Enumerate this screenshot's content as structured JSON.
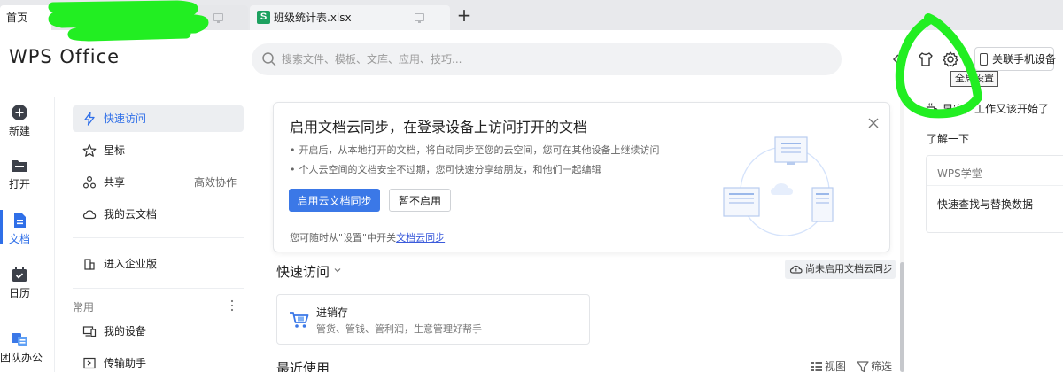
{
  "tabs": {
    "home": "首页",
    "file": {
      "badge": "S",
      "name": "班级统计表.xlsx"
    },
    "add": "+"
  },
  "header": {
    "logo": "WPS Office",
    "search_placeholder": "搜索文件、模板、文库、应用、技巧...",
    "phone_button": "关联手机设备",
    "tooltip": "全局设置"
  },
  "rail": [
    {
      "label": "新建",
      "icon": "plus-circle-icon"
    },
    {
      "label": "打开",
      "icon": "folder-icon"
    },
    {
      "label": "文档",
      "icon": "document-icon"
    },
    {
      "label": "日历",
      "icon": "calendar-icon"
    },
    {
      "label": "团队办公",
      "icon": "team-icon"
    }
  ],
  "nav": {
    "items": [
      {
        "label": "快速访问",
        "icon": "lightning-icon"
      },
      {
        "label": "星标",
        "icon": "star-icon"
      },
      {
        "label": "共享",
        "icon": "share-icon",
        "extra": "高效协作"
      },
      {
        "label": "我的云文档",
        "icon": "cloud-icon"
      },
      {
        "label": "进入企业版",
        "icon": "enterprise-icon"
      }
    ],
    "section_label": "常用",
    "common_items": [
      {
        "label": "我的设备",
        "icon": "device-icon"
      },
      {
        "label": "传输助手",
        "icon": "transfer-icon"
      }
    ]
  },
  "sync_card": {
    "title": "启用文档云同步，在登录设备上访问打开的文档",
    "lines": [
      "开启后，从本地打开的文档，将自动同步至您的云空间，您可在其他设备上继续访问",
      "个人云空间的文档安全不过期，您可快速分享给朋友，和他们一起编辑"
    ],
    "primary_button": "启用云文档同步",
    "secondary_button": "暂不启用",
    "footer_prefix": "您可随时从\"设置\"中开关",
    "footer_link": "文档云同步"
  },
  "quick_access": {
    "title": "快速访问",
    "cloud_status": "尚未启用文档云同步",
    "card": {
      "title": "进销存",
      "subtitle": "管货、管钱、管利润，生意管理好帮手"
    }
  },
  "recent": {
    "title": "最近使用",
    "view_label": "视图",
    "filter_label": "筛选"
  },
  "right_panel": {
    "greeting": "早安，工作又该开始了",
    "learn_more": "了解一下",
    "school": {
      "title": "WPS学堂",
      "item": "快速查找与替换数据"
    }
  },
  "colors": {
    "accent": "#2f6fe8",
    "primary_button": "#3b78e7",
    "sheet_badge": "#1da160",
    "scribble_green": "#22ee22"
  }
}
